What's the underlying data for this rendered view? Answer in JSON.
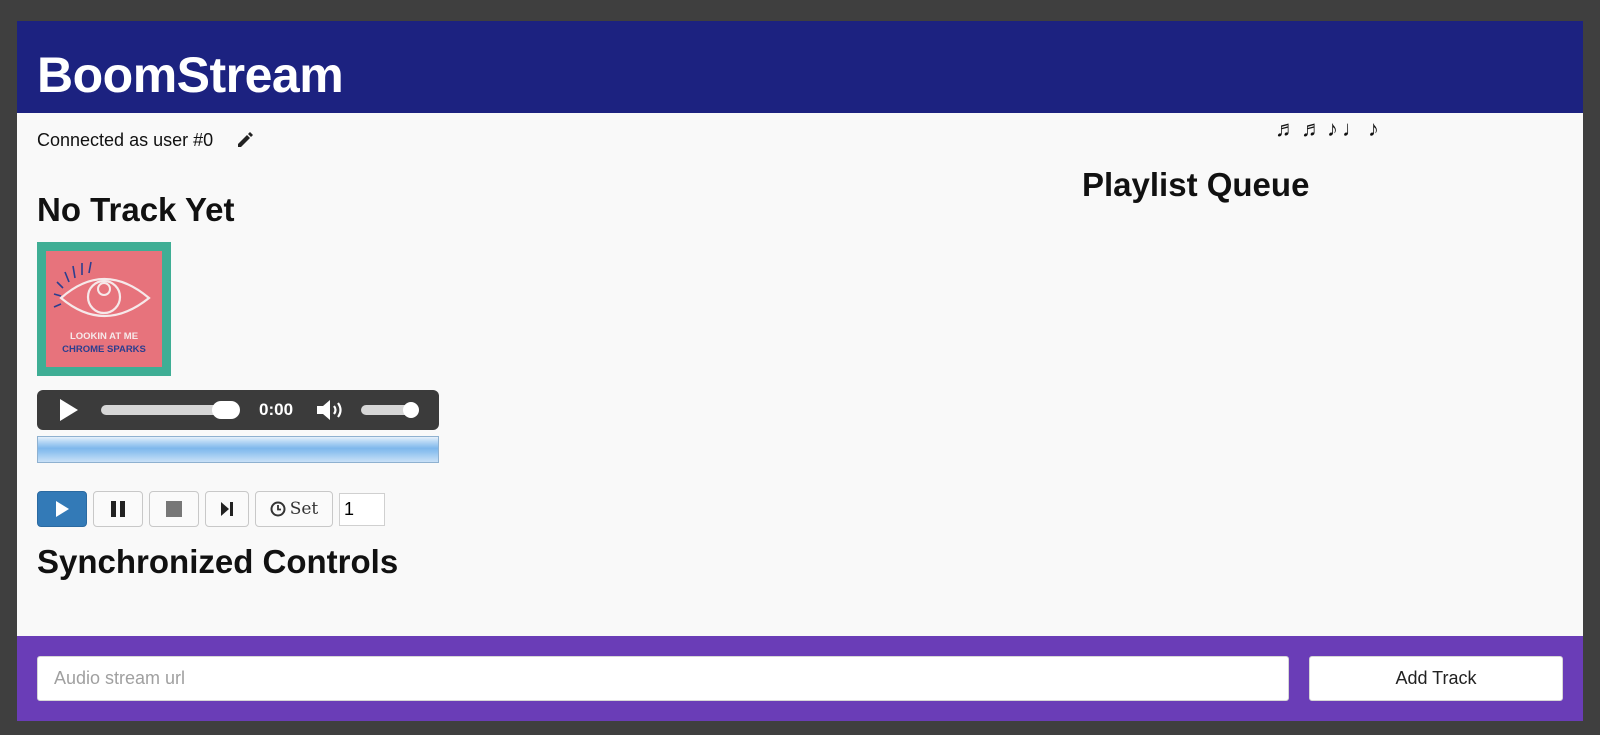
{
  "app": {
    "title": "BoomStream"
  },
  "connection": {
    "text": "Connected as user #0",
    "edit_icon": "pencil-icon"
  },
  "decoration": {
    "notes": "♬♬♪♩♪"
  },
  "now_playing": {
    "title": "No Track Yet",
    "cover_art": {
      "line1": "LOOKIN AT ME",
      "line2": "CHROME SPARKS"
    }
  },
  "player": {
    "time": "0:00",
    "seek_fraction": 0.9,
    "volume_fraction": 0.85
  },
  "controls": {
    "play_icon": "play-icon",
    "pause_icon": "pause-icon",
    "stop_icon": "stop-icon",
    "skip_icon": "skip-next-icon",
    "set_icon": "clock-icon",
    "set_label": "Set",
    "count_value": "1"
  },
  "sections": {
    "synchronized_controls": "Synchronized Controls",
    "playlist_queue": "Playlist Queue"
  },
  "footer": {
    "url_placeholder": "Audio stream url",
    "add_label": "Add Track"
  },
  "colors": {
    "header_bg": "#1c2280",
    "footer_bg": "#6a3db7",
    "primary_button": "#337ab7",
    "cover_teal": "#3fae95",
    "cover_pink": "#e7737c"
  }
}
